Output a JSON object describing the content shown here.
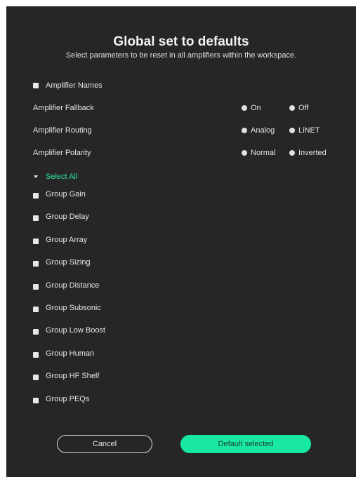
{
  "dialog": {
    "title": "Global set to defaults",
    "subtitle": "Select parameters to be reset in all amplifiers within the workspace."
  },
  "amplifier_names": {
    "label": "Amplifier Names"
  },
  "settings": [
    {
      "label": "Amplifier Fallback",
      "options": [
        "On",
        "Off"
      ]
    },
    {
      "label": "Amplifier Routing",
      "options": [
        "Analog",
        "LiNET"
      ]
    },
    {
      "label": "Amplifier Polarity",
      "options": [
        "Normal",
        "Inverted"
      ]
    }
  ],
  "select_all": {
    "label": "Select All",
    "color": "#2ee89c"
  },
  "groups": [
    "Group Gain",
    "Group Delay",
    "Group Array",
    "Group Sizing",
    "Group Distance",
    "Group Subsonic",
    "Group Low Boost",
    "Group Human",
    "Group HF Shelf",
    "Group PEQs"
  ],
  "buttons": {
    "cancel": "Cancel",
    "default_selected": "Default selected"
  },
  "colors": {
    "background": "#262626",
    "accent": "#19e8a2"
  }
}
